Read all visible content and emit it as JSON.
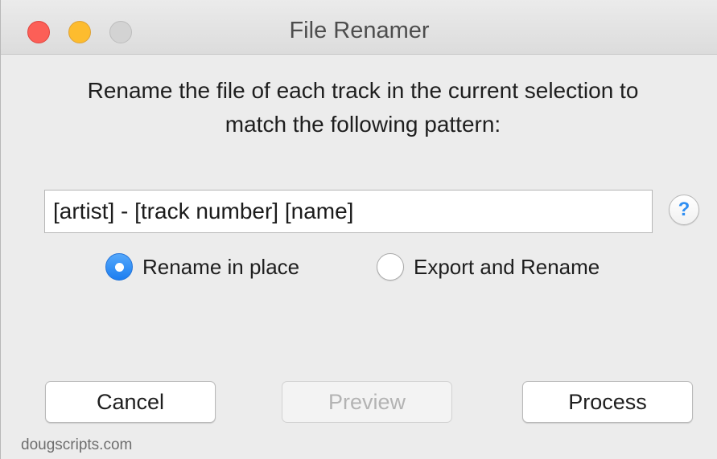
{
  "window": {
    "title": "File Renamer"
  },
  "prompt": {
    "line1": "Rename the file of each track in the current selection to",
    "line2": "match the following pattern:"
  },
  "pattern_field": {
    "value": "[artist] - [track number] [name]"
  },
  "help": {
    "label": "?"
  },
  "options": {
    "rename_in_place": {
      "label": "Rename in place",
      "selected": true
    },
    "export_and_rename": {
      "label": "Export and Rename",
      "selected": false
    }
  },
  "buttons": {
    "cancel": "Cancel",
    "preview": "Preview",
    "process": "Process"
  },
  "footer": {
    "text": "dougscripts.com"
  },
  "colors": {
    "close": "#fc5f57",
    "minimize": "#fdbc2e",
    "zoom_inactive": "#d3d3d3",
    "accent": "#1c7ef0"
  }
}
